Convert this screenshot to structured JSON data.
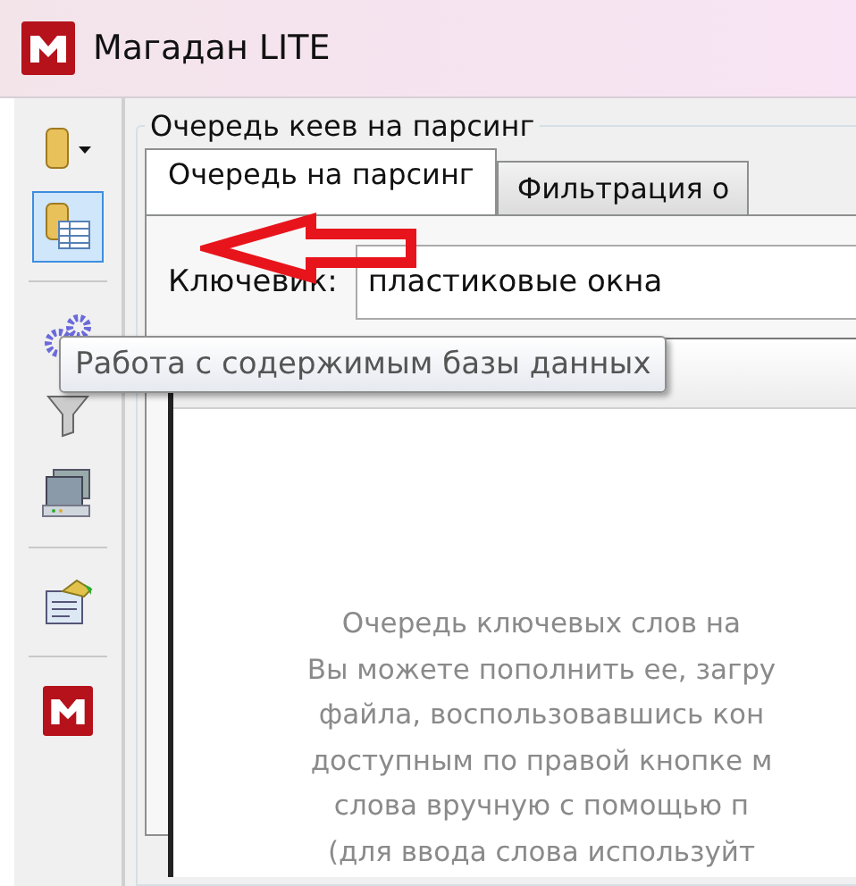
{
  "window": {
    "title": "Магадан LITE"
  },
  "toolbar": {
    "items": [
      {
        "kind": "database",
        "selected": false
      },
      {
        "kind": "table",
        "selected": true
      },
      {
        "kind": "separator"
      },
      {
        "kind": "gears",
        "selected": false
      },
      {
        "kind": "funnel",
        "selected": false
      },
      {
        "kind": "computer",
        "selected": false
      },
      {
        "kind": "separator"
      },
      {
        "kind": "document",
        "selected": false
      },
      {
        "kind": "separator"
      },
      {
        "kind": "logo",
        "selected": false
      }
    ]
  },
  "group": {
    "title": "Очередь кеев на парсинг"
  },
  "tabs": [
    {
      "label": "Очередь на парсинг",
      "selected": true
    },
    {
      "label": "Фильтрация о",
      "selected": false
    }
  ],
  "keyword": {
    "label": "Ключевик:",
    "value": "пластиковые окна"
  },
  "empty_message": [
    "Очередь ключевых слов на",
    "Вы можете пополнить ее, загру",
    "файла, воспользовавшись кон",
    "доступным по правой кнопке м",
    "слова вручную с помощью п",
    "(для ввода слова используйт"
  ],
  "tooltip": {
    "text": "Работа с содержимым базы данных"
  }
}
